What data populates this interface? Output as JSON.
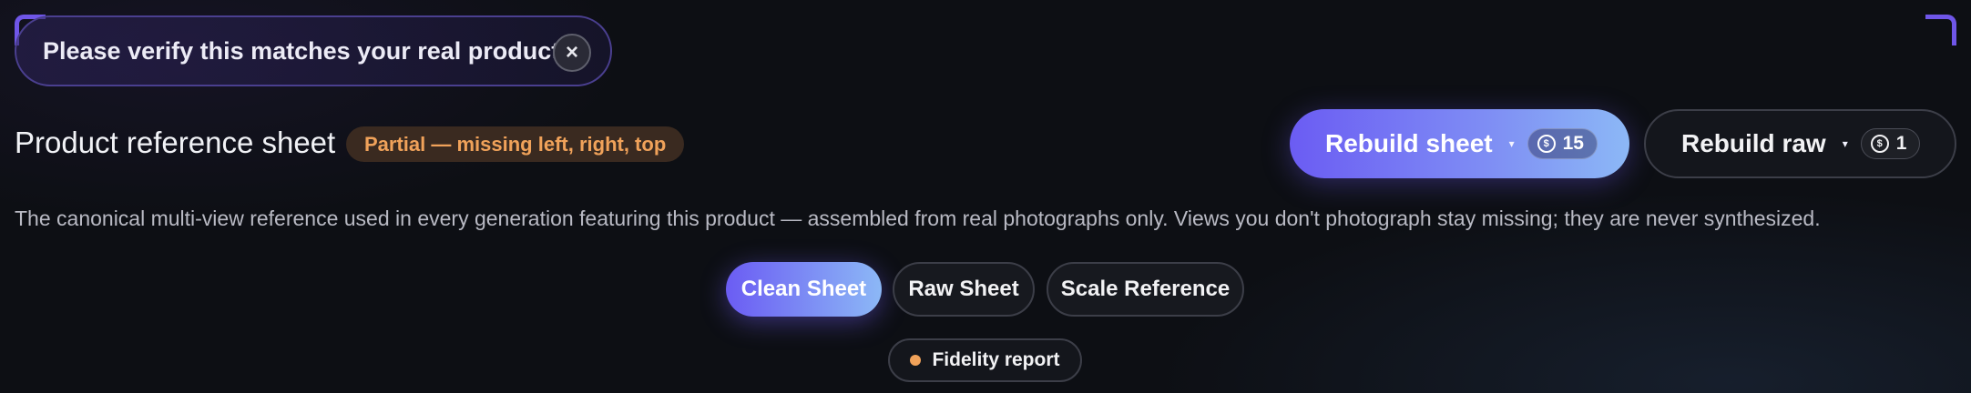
{
  "toast": {
    "message": "Please verify this matches your real product",
    "close_symbol": "×"
  },
  "header": {
    "title": "Product reference sheet",
    "status_badge": "Partial — missing left, right, top",
    "status_color": "#f0a25a"
  },
  "actions": {
    "rebuild_sheet": {
      "label": "Rebuild sheet",
      "caret": "▾",
      "credits": "15",
      "credit_icon": "coin-icon"
    },
    "rebuild_raw": {
      "label": "Rebuild raw",
      "caret": "▾",
      "credits": "1",
      "credit_icon": "coin-icon"
    }
  },
  "description": "The canonical multi-view reference used in every generation featuring this product — assembled from real photographs only. Views you don't photograph stay missing; they are never synthesized.",
  "tabs": [
    {
      "label": "Clean Sheet",
      "active": true
    },
    {
      "label": "Raw Sheet",
      "active": false
    },
    {
      "label": "Scale Reference",
      "active": false
    }
  ],
  "fidelity": {
    "label": "Fidelity report",
    "status_color": "#f0a25a"
  },
  "colors": {
    "accent_start": "#6b5cf3",
    "accent_end": "#8cb8f6",
    "background": "#0d0f14"
  }
}
